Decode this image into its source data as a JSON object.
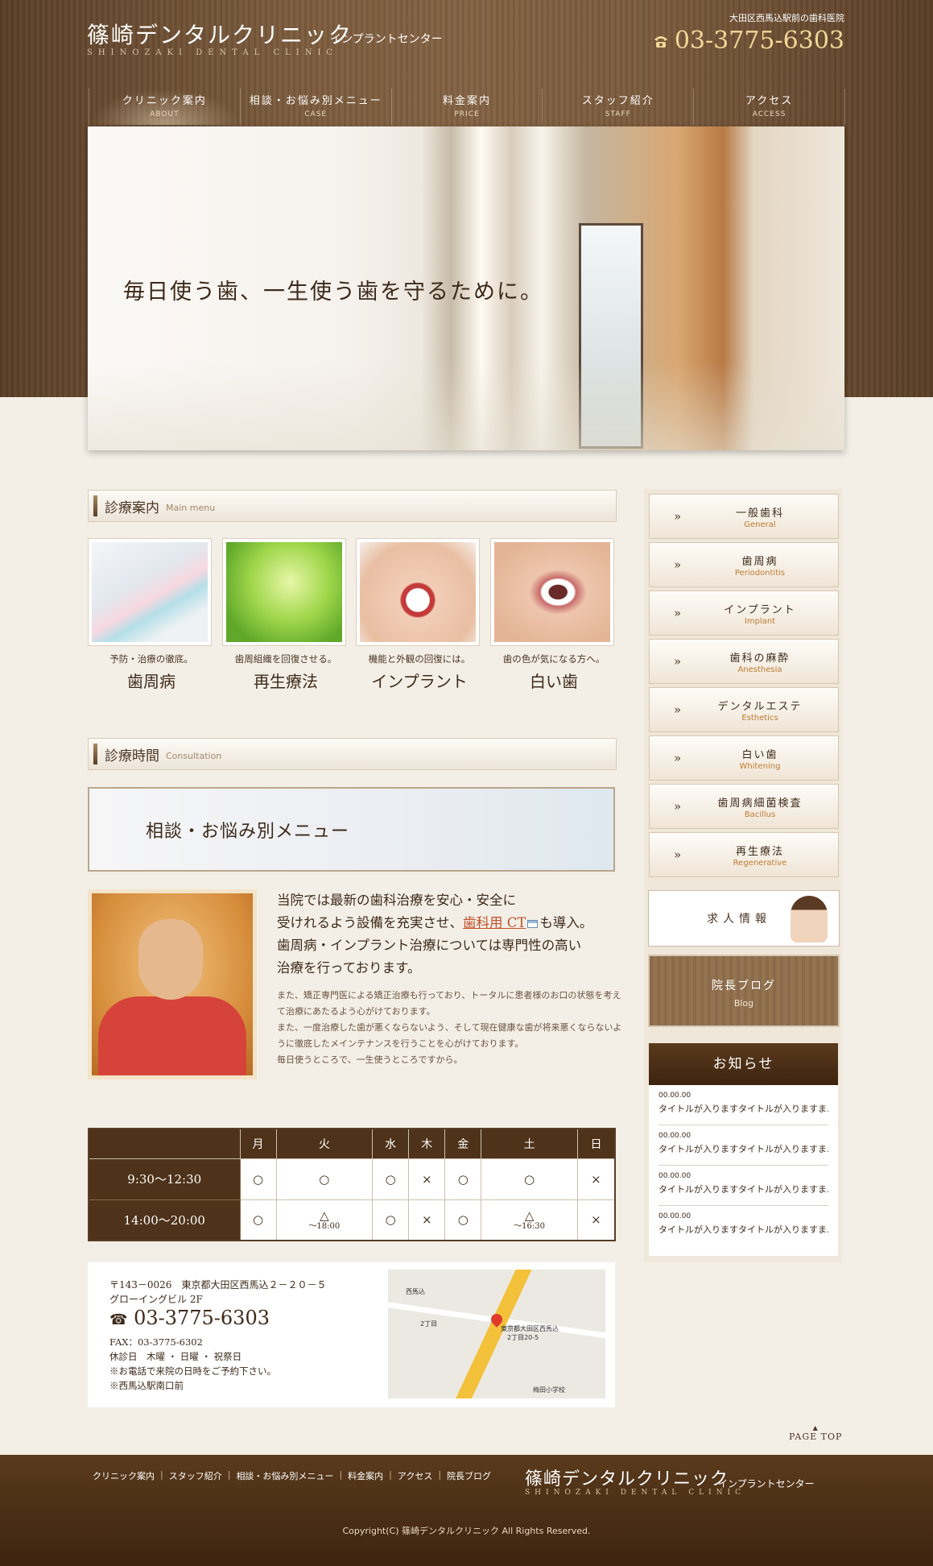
{
  "header": {
    "logo_main": "篠崎デンタルクリニック",
    "logo_sub": "インプラントセンター",
    "logo_en": "SHINOZAKI DENTAL CLINIC",
    "tagline": "大田区西馬込駅前の歯科医院",
    "phone": "03-3775-6303",
    "phone_icon": "phone-icon"
  },
  "nav": [
    {
      "jp": "クリニック案内",
      "en": "ABOUT"
    },
    {
      "jp": "相談・お悩み別メニュー",
      "en": "CASE"
    },
    {
      "jp": "料金案内",
      "en": "PRICE"
    },
    {
      "jp": "スタッフ紹介",
      "en": "STAFF"
    },
    {
      "jp": "アクセス",
      "en": "ACCESS"
    }
  ],
  "hero": {
    "copy": "毎日使う歯、一生使う歯を守るために。"
  },
  "main_menu": {
    "title": "診療案内",
    "title_en": "Main menu",
    "cards": [
      {
        "desc": "予防・治療の徹底。",
        "name": "歯周病"
      },
      {
        "desc": "歯周組織を回復させる。",
        "name": "再生療法"
      },
      {
        "desc": "機能と外観の回復には。",
        "name": "インプラント"
      },
      {
        "desc": "歯の色が気になる方へ。",
        "name": "白い歯"
      }
    ]
  },
  "consultation": {
    "title": "診療時間",
    "title_en": "Consultation",
    "banner": "相談・お悩み別メニュー"
  },
  "intro": {
    "line1": "当院では最新の歯科治療を安心・安全に",
    "line2_pre": "受けれるよう設備を充実させ、",
    "line2_link": "歯科用 CT",
    "line2_post": "も導入。",
    "line3": "歯周病・インプラント治療については専門性の高い",
    "line4": "治療を行っております。",
    "p1": "また、矯正専門医による矯正治療も行っており、トータルに患者様のお口の状態を考えて治療にあたるよう心がけております。",
    "p2": "また、一度治療した歯が悪くならないよう、そして現在健康な歯が将来悪くならないように徹底したメインテナンスを行うことを心がけております。",
    "p3": "毎日使うところで、一生使うところですから。"
  },
  "schedule": {
    "days": [
      "月",
      "火",
      "水",
      "木",
      "金",
      "土",
      "日"
    ],
    "rows": [
      {
        "time": "9:30～12:30",
        "cells": [
          {
            "m": "○",
            "s": ""
          },
          {
            "m": "○",
            "s": ""
          },
          {
            "m": "○",
            "s": ""
          },
          {
            "m": "×",
            "s": ""
          },
          {
            "m": "○",
            "s": ""
          },
          {
            "m": "○",
            "s": ""
          },
          {
            "m": "×",
            "s": ""
          }
        ]
      },
      {
        "time": "14:00～20:00",
        "cells": [
          {
            "m": "○",
            "s": ""
          },
          {
            "m": "△",
            "s": "～18:00"
          },
          {
            "m": "○",
            "s": ""
          },
          {
            "m": "×",
            "s": ""
          },
          {
            "m": "○",
            "s": ""
          },
          {
            "m": "△",
            "s": "～16:30"
          },
          {
            "m": "×",
            "s": ""
          }
        ]
      }
    ]
  },
  "access": {
    "address1": "〒143－0026　東京都大田区西馬込２－２０－５",
    "address2": "グローイングビル 2F",
    "tel": "03-3775-6303",
    "fax": "FAX：03-3775-6302",
    "holidays": "休診日　木曜 ・ 日曜 ・ 祝祭日",
    "note1": "※お電話で来院の日時をご予約下さい。",
    "note2": "※西馬込駅南口前",
    "map_labels": [
      "西馬込",
      "2丁目",
      "東京都大田区西馬込",
      "2丁目20-5",
      "梅田小学校"
    ]
  },
  "sidebar": {
    "items": [
      {
        "jp": "一般歯科",
        "en": "General"
      },
      {
        "jp": "歯周病",
        "en": "Periodontitis"
      },
      {
        "jp": "インプラント",
        "en": "Implant"
      },
      {
        "jp": "歯科の麻酔",
        "en": "Anesthesia"
      },
      {
        "jp": "デンタルエステ",
        "en": "Esthetics"
      },
      {
        "jp": "白い歯",
        "en": "Whitening"
      },
      {
        "jp": "歯周病細菌検査",
        "en": "Bacillus"
      },
      {
        "jp": "再生療法",
        "en": "Regenerative"
      }
    ],
    "arrow": "»",
    "recruit": "求人情報",
    "blog_jp": "院長ブログ",
    "blog_en": "Blog"
  },
  "news": {
    "title": "お知らせ",
    "items": [
      {
        "date": "00.00.00",
        "title": "タイトルが入りますタイトルが入りますま…"
      },
      {
        "date": "00.00.00",
        "title": "タイトルが入りますタイトルが入りますま…"
      },
      {
        "date": "00.00.00",
        "title": "タイトルが入りますタイトルが入りますま…"
      },
      {
        "date": "00.00.00",
        "title": "タイトルが入りますタイトルが入りますま…"
      }
    ]
  },
  "footer": {
    "pagetop": "PAGE TOP",
    "links": [
      "クリニック案内",
      "スタッフ紹介",
      "相談・お悩み別メニュー",
      "料金案内",
      "アクセス",
      "院長ブログ"
    ],
    "logo_main": "篠崎デンタルクリニック",
    "logo_sub": "インプラントセンター",
    "logo_en": "SHINOZAKI DENTAL CLINIC",
    "copyright": "Copyright(C) 篠崎デンタルクリニック All Rights Reserved."
  },
  "colors": {
    "brand_brown": "#5a3e26",
    "accent_gold": "#f2d79a",
    "link": "#c0502a"
  }
}
